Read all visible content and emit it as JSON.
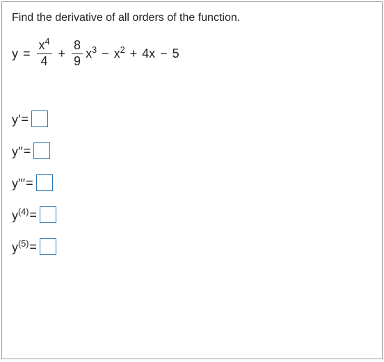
{
  "instruction": "Find the derivative of all orders of the function.",
  "equation": {
    "lhs": "y",
    "frac1_num_base": "x",
    "frac1_num_exp": "4",
    "frac1_den": "4",
    "frac2_num": "8",
    "frac2_den": "9",
    "term2_base": "x",
    "term2_exp": "3",
    "term3_base": "x",
    "term3_exp": "2",
    "term4": "4x",
    "term5": "5"
  },
  "answers": [
    {
      "label_base": "y",
      "label_prime": "′",
      "label_exp": "",
      "eq": " = "
    },
    {
      "label_base": "y",
      "label_prime": "′′",
      "label_exp": "",
      "eq": " = "
    },
    {
      "label_base": "y",
      "label_prime": "′′′",
      "label_exp": "",
      "eq": " = "
    },
    {
      "label_base": "y",
      "label_prime": "",
      "label_exp": "(4)",
      "eq": " = "
    },
    {
      "label_base": "y",
      "label_prime": "",
      "label_exp": "(5)",
      "eq": " = "
    }
  ]
}
